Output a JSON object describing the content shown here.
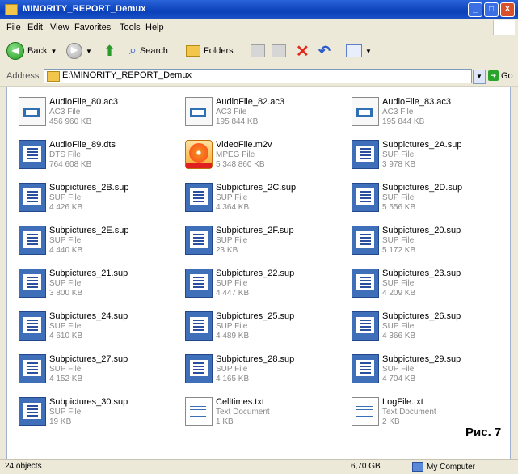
{
  "window": {
    "title": "MINORITY_REPORT_Demux",
    "buttons": [
      "_",
      "□",
      "X"
    ]
  },
  "menu": {
    "items": [
      "File",
      "Edit",
      "View",
      "Favorites",
      "Tools",
      "Help"
    ]
  },
  "toolbar": {
    "back_label": "Back",
    "search_label": "Search",
    "folders_label": "Folders"
  },
  "address": {
    "label": "Address",
    "path": "E:\\MINORITY_REPORT_Demux",
    "go_label": "Go"
  },
  "files": [
    {
      "name": "AudioFile_80.ac3",
      "type": "AC3 File",
      "size": "456 960 KB",
      "icon": "ac3-file-icon"
    },
    {
      "name": "AudioFile_82.ac3",
      "type": "AC3 File",
      "size": "195 844 KB",
      "icon": "ac3-file-icon"
    },
    {
      "name": "AudioFile_83.ac3",
      "type": "AC3 File",
      "size": "195 844 KB",
      "icon": "ac3-file-icon"
    },
    {
      "name": "AudioFile_89.dts",
      "type": "DTS File",
      "size": "764 608 KB",
      "icon": "dts-file-icon"
    },
    {
      "name": "VideoFile.m2v",
      "type": "MPEG File",
      "size": "5 348 860 KB",
      "icon": "video-file-icon"
    },
    {
      "name": "Subpictures_2A.sup",
      "type": "SUP File",
      "size": "3 978 KB",
      "icon": "sup-file-icon"
    },
    {
      "name": "Subpictures_2B.sup",
      "type": "SUP File",
      "size": "4 426 KB",
      "icon": "sup-file-icon"
    },
    {
      "name": "Subpictures_2C.sup",
      "type": "SUP File",
      "size": "4 364 KB",
      "icon": "sup-file-icon"
    },
    {
      "name": "Subpictures_2D.sup",
      "type": "SUP File",
      "size": "5 556 KB",
      "icon": "sup-file-icon"
    },
    {
      "name": "Subpictures_2E.sup",
      "type": "SUP File",
      "size": "4 440 KB",
      "icon": "sup-file-icon"
    },
    {
      "name": "Subpictures_2F.sup",
      "type": "SUP File",
      "size": "23 KB",
      "icon": "sup-file-icon"
    },
    {
      "name": "Subpictures_20.sup",
      "type": "SUP File",
      "size": "5 172 KB",
      "icon": "sup-file-icon"
    },
    {
      "name": "Subpictures_21.sup",
      "type": "SUP File",
      "size": "3 800 KB",
      "icon": "sup-file-icon"
    },
    {
      "name": "Subpictures_22.sup",
      "type": "SUP File",
      "size": "4 447 KB",
      "icon": "sup-file-icon"
    },
    {
      "name": "Subpictures_23.sup",
      "type": "SUP File",
      "size": "4 209 KB",
      "icon": "sup-file-icon"
    },
    {
      "name": "Subpictures_24.sup",
      "type": "SUP File",
      "size": "4 610 KB",
      "icon": "sup-file-icon"
    },
    {
      "name": "Subpictures_25.sup",
      "type": "SUP File",
      "size": "4 489 KB",
      "icon": "sup-file-icon"
    },
    {
      "name": "Subpictures_26.sup",
      "type": "SUP File",
      "size": "4 366 KB",
      "icon": "sup-file-icon"
    },
    {
      "name": "Subpictures_27.sup",
      "type": "SUP File",
      "size": "4 152 KB",
      "icon": "sup-file-icon"
    },
    {
      "name": "Subpictures_28.sup",
      "type": "SUP File",
      "size": "4 165 KB",
      "icon": "sup-file-icon"
    },
    {
      "name": "Subpictures_29.sup",
      "type": "SUP File",
      "size": "4 704 KB",
      "icon": "sup-file-icon"
    },
    {
      "name": "Subpictures_30.sup",
      "type": "SUP File",
      "size": "19 KB",
      "icon": "sup-file-icon"
    },
    {
      "name": "Celltimes.txt",
      "type": "Text Document",
      "size": "1 KB",
      "icon": "text-file-icon"
    },
    {
      "name": "LogFile.txt",
      "type": "Text Document",
      "size": "2 KB",
      "icon": "text-file-icon"
    }
  ],
  "caption": "Рис. 7",
  "status": {
    "objects": "24 objects",
    "size": "6,70 GB",
    "location": "My Computer"
  }
}
